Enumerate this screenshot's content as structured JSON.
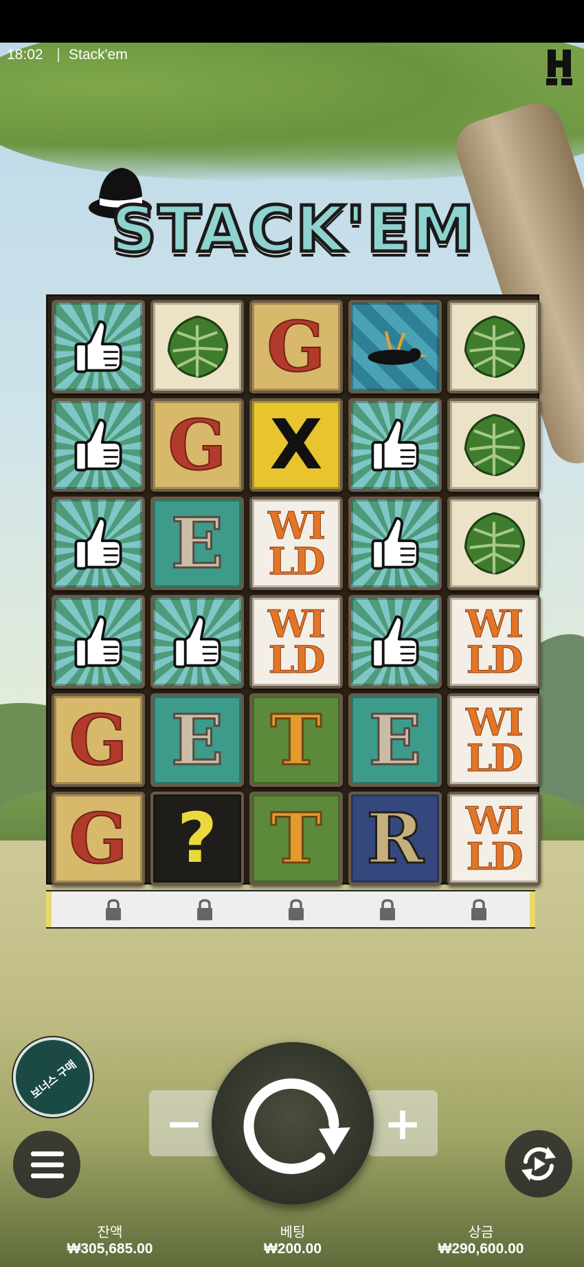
{
  "status_bar": {
    "time": "18:02",
    "app_title": "Stack'em"
  },
  "logo": {
    "text": "STACK'EM"
  },
  "reels": {
    "rows": [
      [
        "thumbs-up",
        "leaf",
        "G",
        "bird",
        "leaf"
      ],
      [
        "thumbs-up",
        "G",
        "X",
        "thumbs-up",
        "leaf"
      ],
      [
        "thumbs-up",
        "E",
        "WILD",
        "thumbs-up",
        "leaf"
      ],
      [
        "thumbs-up",
        "thumbs-up",
        "WILD",
        "thumbs-up",
        "WILD"
      ],
      [
        "G",
        "E",
        "T",
        "E",
        "WILD"
      ],
      [
        "G",
        "?",
        "T",
        "R",
        "WILD"
      ]
    ]
  },
  "lock_row": {
    "count": 5,
    "icon": "lock-icon"
  },
  "controls": {
    "bonus_buy_label": "보너스 구매",
    "minus_label": "−",
    "plus_label": "+",
    "menu_icon": "hamburger-icon",
    "spin_icon": "spin-arrow-icon",
    "autoplay_icon": "autoplay-icon"
  },
  "footer": {
    "balance_label": "잔액",
    "balance_value": "₩305,685.00",
    "bet_label": "베팅",
    "bet_value": "₩200.00",
    "win_label": "상금",
    "win_value": "₩290,600.00"
  }
}
